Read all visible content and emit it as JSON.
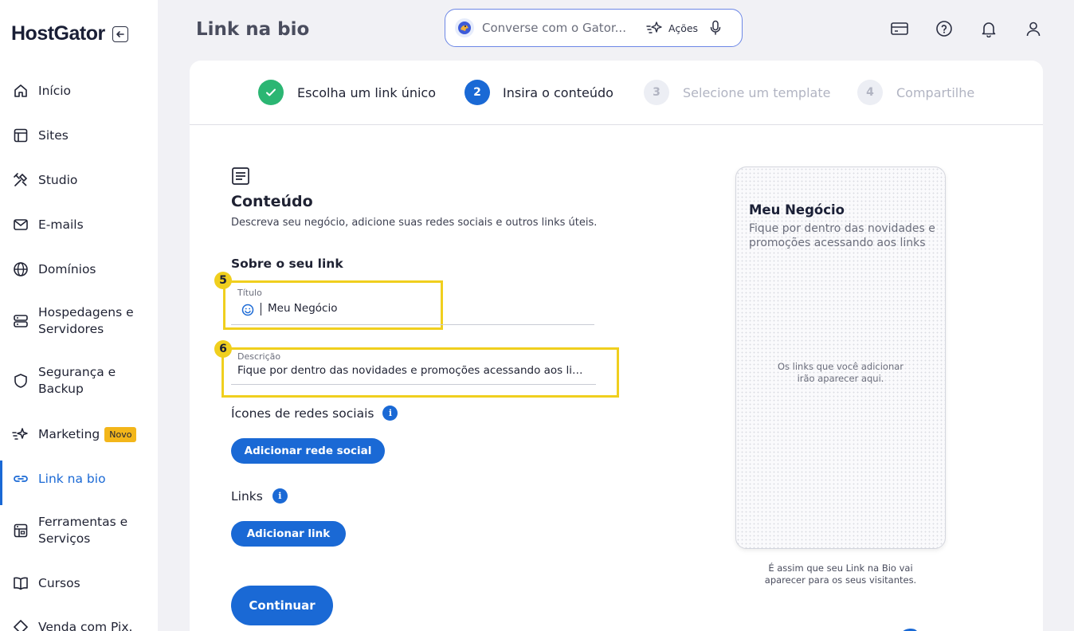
{
  "sidebar": {
    "logo": "HostGator",
    "items": [
      {
        "label": "Início",
        "icon": "home-icon"
      },
      {
        "label": "Sites",
        "icon": "layout-icon"
      },
      {
        "label": "Studio",
        "icon": "tools-icon"
      },
      {
        "label": "E-mails",
        "icon": "mail-icon"
      },
      {
        "label": "Domínios",
        "icon": "globe-icon"
      },
      {
        "label": "Hospedagens e Servidores",
        "icon": "server-icon"
      },
      {
        "label": "Segurança e Backup",
        "icon": "shield-icon"
      },
      {
        "label": "Marketing",
        "icon": "sparkle-icon",
        "badge": "Novo"
      },
      {
        "label": "Link na bio",
        "icon": "link-icon",
        "active": true
      },
      {
        "label": "Ferramentas e Serviços",
        "icon": "toolbox-icon"
      },
      {
        "label": "Cursos",
        "icon": "book-icon"
      },
      {
        "label": "Venda com Pix.",
        "icon": "pix-icon"
      }
    ]
  },
  "header": {
    "title": "Link na bio",
    "search_placeholder": "Converse com o Gator...",
    "actions_label": "Ações"
  },
  "stepper": {
    "steps": [
      {
        "number": "",
        "label": "Escolha um link único",
        "state": "done"
      },
      {
        "number": "2",
        "label": "Insira o conteúdo",
        "state": "current"
      },
      {
        "number": "3",
        "label": "Selecione um template",
        "state": "future"
      },
      {
        "number": "4",
        "label": "Compartilhe",
        "state": "future"
      }
    ]
  },
  "content": {
    "heading": "Conteúdo",
    "subtitle": "Descreva seu negócio, adicione suas redes sociais e outros links úteis.",
    "about_heading": "Sobre o seu link",
    "title_field": {
      "label": "Título",
      "value": "Meu Negócio",
      "marker": "5"
    },
    "description_field": {
      "label": "Descrição",
      "value": "Fique por dentro das novidades e promoções acessando aos links",
      "marker": "6"
    },
    "social_heading": "Ícones de redes sociais",
    "add_social_button": "Adicionar rede social",
    "links_heading": "Links",
    "add_link_button": "Adicionar link",
    "continue_button": "Continuar",
    "info_glyph": "i"
  },
  "preview": {
    "title": "Meu Negócio",
    "description": "Fique por dentro das novidades e promoções acessando aos links",
    "empty_text": "Os links que você adicionar irão aparecer aqui.",
    "caption": "É assim que seu Link na Bio vai aparecer para os seus visitantes."
  },
  "colors": {
    "primary": "#1a69d5",
    "success": "#2bb673",
    "highlight": "#f0cf1e",
    "badge": "#f3b61a"
  }
}
